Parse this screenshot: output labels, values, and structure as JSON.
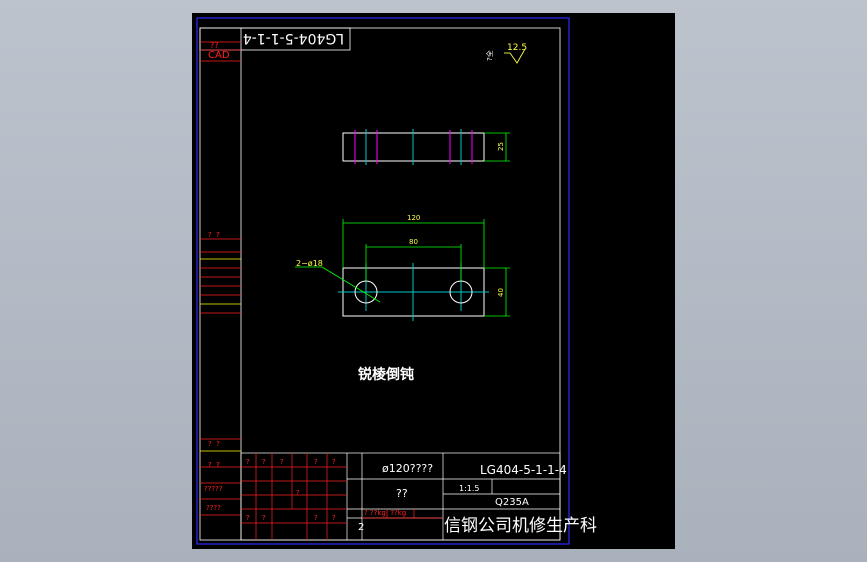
{
  "colors": {
    "background": "#000000",
    "border": "#2b2bff",
    "frame": "#ffffff",
    "title_red": "#ff2020",
    "dimension": "#00ff00",
    "center_line": "#00c8c8",
    "hidden_line": "#ff00ff",
    "yellow_text": "#ffff40",
    "lines_yellow": "#ffff00"
  },
  "drawing": {
    "rotated_code": "LG404-5-1-1-4",
    "side_codes": [
      "??",
      "CAD"
    ],
    "surface_finish": "12.5",
    "surface_note": "?全",
    "dims": {
      "height_top": "25",
      "length": "120",
      "hole_spacing": "80",
      "holes": "2−ø18",
      "height_plan": "40"
    },
    "note": "锐棱倒钝",
    "left_column_marks": [
      "?  ?",
      "?  ?",
      "?  ?",
      "?????",
      "????"
    ],
    "title_block": {
      "part_name": "ø120????",
      "part_code": "LG404-5-1-1-4",
      "material_label": "??",
      "scale": "1:1.5",
      "material": "Q235A",
      "sheet": "2",
      "marks_row1": [
        "?",
        "?",
        "?",
        "?",
        "?"
      ],
      "marks_row2": [
        "?",
        "?",
        "?",
        "?",
        "?"
      ],
      "weight_marks": "? ??kg  ??kg",
      "company": "信钢公司机修生产科"
    }
  }
}
